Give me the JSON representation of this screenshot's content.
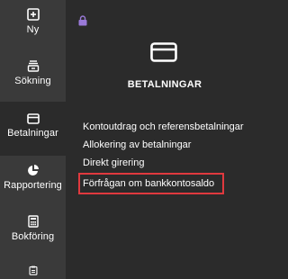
{
  "rail": {
    "items": [
      {
        "label": "Ny",
        "icon": "plus-square-icon"
      },
      {
        "label": "Sökning",
        "icon": "stack-search-icon"
      },
      {
        "label": "Betalningar",
        "icon": "card-icon",
        "active": true
      },
      {
        "label": "Rapportering",
        "icon": "pie-chart-icon"
      },
      {
        "label": "Bokföring",
        "icon": "calculator-icon"
      },
      {
        "label": "",
        "icon": "clipboard-icon"
      }
    ]
  },
  "panel": {
    "title": "BETALNINGAR",
    "items": [
      {
        "label": "Kontoutdrag och referensbetalningar"
      },
      {
        "label": "Allokering av betalningar"
      },
      {
        "label": "Direkt girering"
      },
      {
        "label": "Förfrågan om bankkontosaldo",
        "highlighted": true
      }
    ]
  },
  "colors": {
    "rail_bg": "#3a3a3a",
    "panel_bg": "#2b2b2b",
    "lock": "#9a7ad8",
    "highlight": "#e0393e"
  }
}
